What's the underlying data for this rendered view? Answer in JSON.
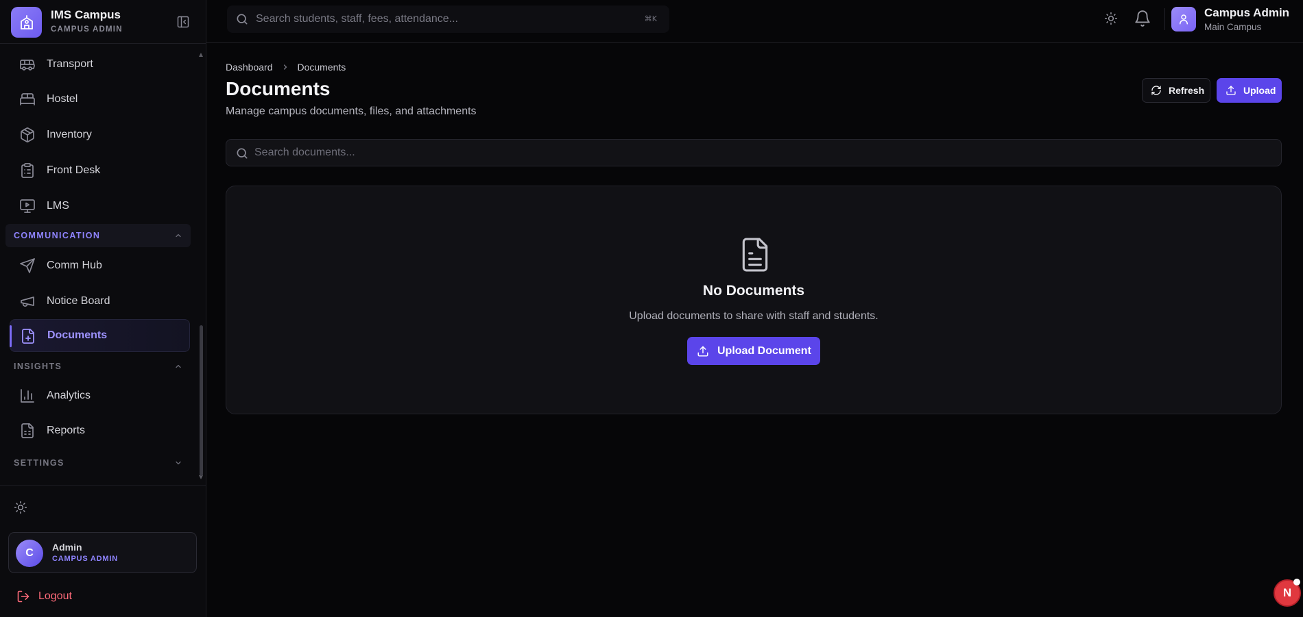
{
  "brand": {
    "title": "IMS Campus",
    "subtitle": "CAMPUS ADMIN"
  },
  "sidebar": {
    "items": [
      {
        "label": "Transport",
        "icon": "bus-icon"
      },
      {
        "label": "Hostel",
        "icon": "bed-icon"
      },
      {
        "label": "Inventory",
        "icon": "package-icon"
      },
      {
        "label": "Front Desk",
        "icon": "clipboard-icon"
      },
      {
        "label": "LMS",
        "icon": "monitor-play-icon"
      }
    ],
    "sections": {
      "communication": {
        "label": "COMMUNICATION",
        "expanded": true
      },
      "insights": {
        "label": "INSIGHTS",
        "expanded": true
      },
      "settings": {
        "label": "SETTINGS",
        "expanded": false
      }
    },
    "communication_items": [
      {
        "label": "Comm Hub",
        "icon": "send-icon"
      },
      {
        "label": "Notice Board",
        "icon": "megaphone-icon"
      },
      {
        "label": "Documents",
        "icon": "file-plus-icon",
        "active": true
      }
    ],
    "insights_items": [
      {
        "label": "Analytics",
        "icon": "bar-chart-icon"
      },
      {
        "label": "Reports",
        "icon": "file-spreadsheet-icon"
      }
    ],
    "user": {
      "avatar_letter": "C",
      "name": "Admin",
      "role": "CAMPUS ADMIN"
    },
    "logout_label": "Logout"
  },
  "topbar": {
    "search_placeholder": "Search students, staff, fees, attendance...",
    "shortcut": "⌘K",
    "profile_name": "Campus Admin",
    "profile_sub": "Main Campus"
  },
  "breadcrumb": [
    "Dashboard",
    "Documents"
  ],
  "page": {
    "title": "Documents",
    "subtitle": "Manage campus documents, files, and attachments",
    "refresh_label": "Refresh",
    "upload_label": "Upload",
    "search_placeholder": "Search documents..."
  },
  "empty_state": {
    "title": "No Documents",
    "text": "Upload documents to share with staff and students.",
    "button_label": "Upload Document"
  },
  "floating_badge": "N",
  "colors": {
    "accent": "#5b45ea",
    "accent_text": "#8f84ff",
    "danger": "#ff6b7a",
    "badge": "#e0383f"
  }
}
